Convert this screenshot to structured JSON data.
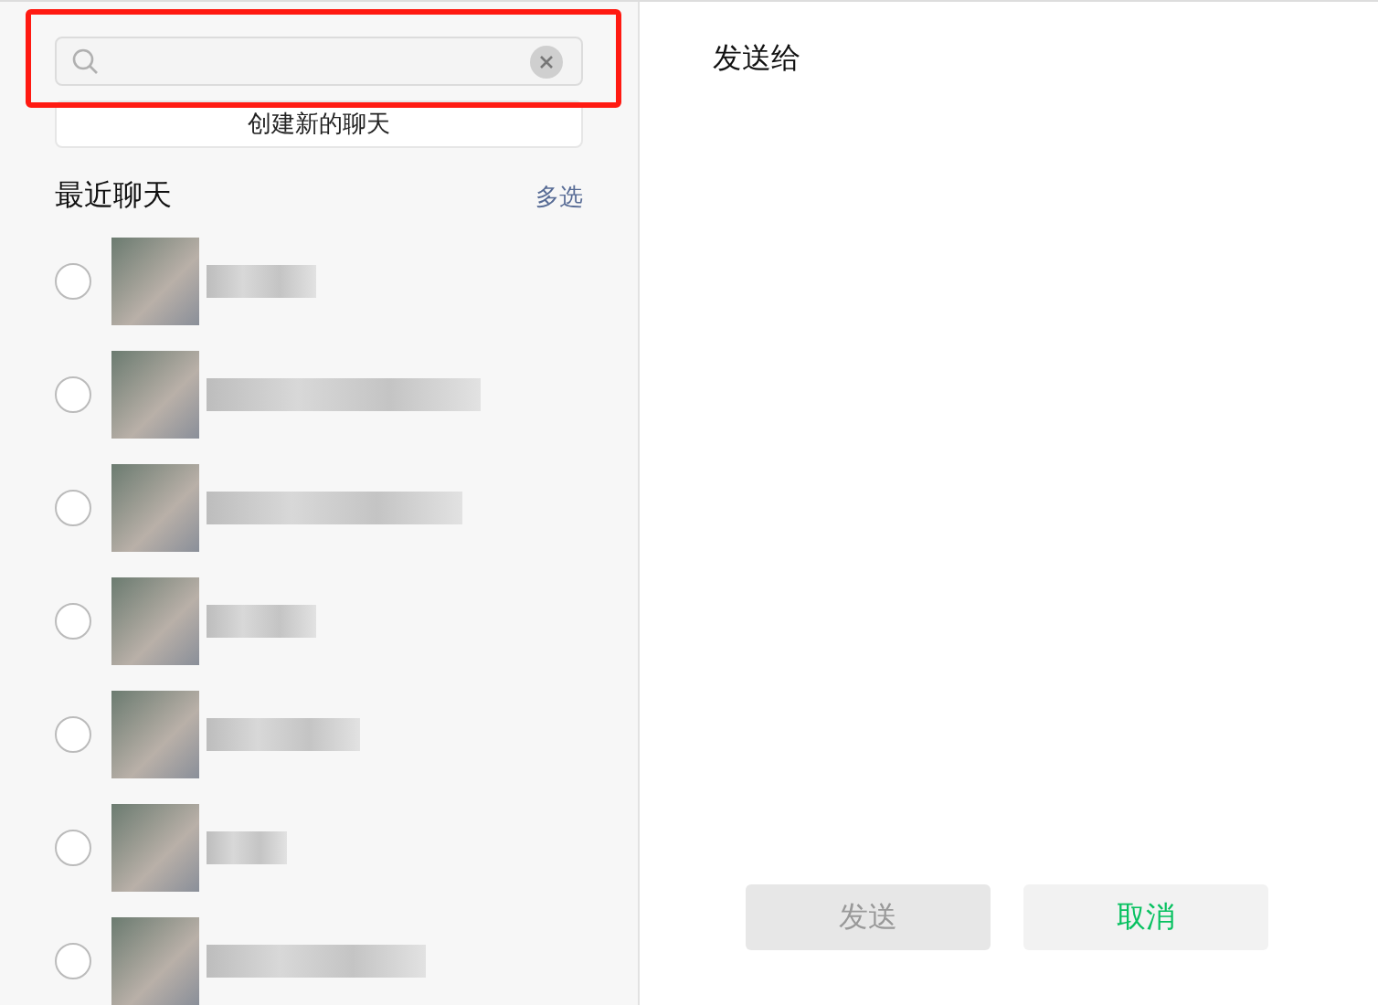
{
  "create_chat": "创建新的聊天",
  "recent": {
    "title": "最近聊天",
    "multi_select": "多选"
  },
  "contacts": [
    {
      "selected": false
    },
    {
      "selected": false
    },
    {
      "selected": false
    },
    {
      "selected": false
    },
    {
      "selected": false
    },
    {
      "selected": false
    },
    {
      "selected": false
    }
  ],
  "panel_title": "发送给",
  "buttons": [
    {
      "label": "发送",
      "kind": "primary",
      "disabled": true
    },
    {
      "label": "取消",
      "kind": "cancel",
      "disabled": false
    }
  ]
}
